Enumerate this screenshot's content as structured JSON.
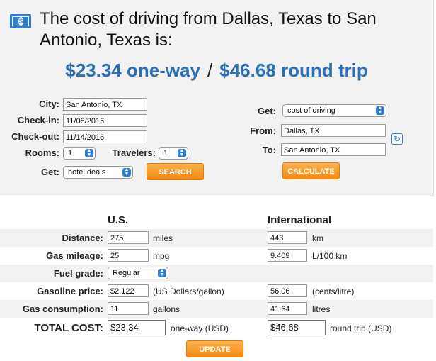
{
  "header": {
    "title": "The cost of driving from Dallas, Texas to San Antonio, Texas is:",
    "cost_oneway": "$23.34 one-way",
    "separator": "/",
    "cost_roundtrip": "$46.68 round trip",
    "icon": "money-icon"
  },
  "hotel_form": {
    "city_label": "City:",
    "city_value": "San Antonio, TX",
    "checkin_label": "Check-in:",
    "checkin_value": "11/08/2016",
    "checkout_label": "Check-out:",
    "checkout_value": "11/14/2016",
    "rooms_label": "Rooms:",
    "rooms_value": "1",
    "travelers_label": "Travelers:",
    "travelers_value": "1",
    "get_label": "Get:",
    "get_value": "hotel deals",
    "search_button": "SEARCH"
  },
  "drive_form": {
    "get_label": "Get:",
    "get_value": "cost of driving",
    "from_label": "From:",
    "from_value": "Dallas, TX",
    "to_label": "To:",
    "to_value": "San Antonio, TX",
    "calculate_button": "CALCULATE",
    "swap_icon": "swap-icon"
  },
  "results": {
    "us_header": "U.S.",
    "intl_header": "International",
    "distance_label": "Distance:",
    "distance_us": "275",
    "distance_us_unit": "miles",
    "distance_intl": "443",
    "distance_intl_unit": "km",
    "mileage_label": "Gas mileage:",
    "mileage_us": "25",
    "mileage_us_unit": "mpg",
    "mileage_intl": "9.409",
    "mileage_intl_unit": "L/100 km",
    "fuel_label": "Fuel grade:",
    "fuel_value": "Regular",
    "price_label": "Gasoline price:",
    "price_us": "$2.122",
    "price_us_unit": "(US Dollars/gallon)",
    "price_intl": "56.06",
    "price_intl_unit": "(cents/litre)",
    "consumption_label": "Gas consumption:",
    "consumption_us": "11",
    "consumption_us_unit": "gallons",
    "consumption_intl": "41.64",
    "consumption_intl_unit": "litres",
    "total_label": "TOTAL COST:",
    "total_us": "$23.34",
    "total_us_unit": "one-way (USD)",
    "total_intl": "$46.68",
    "total_intl_unit": "round trip (USD)",
    "update_button": "UPDATE"
  }
}
